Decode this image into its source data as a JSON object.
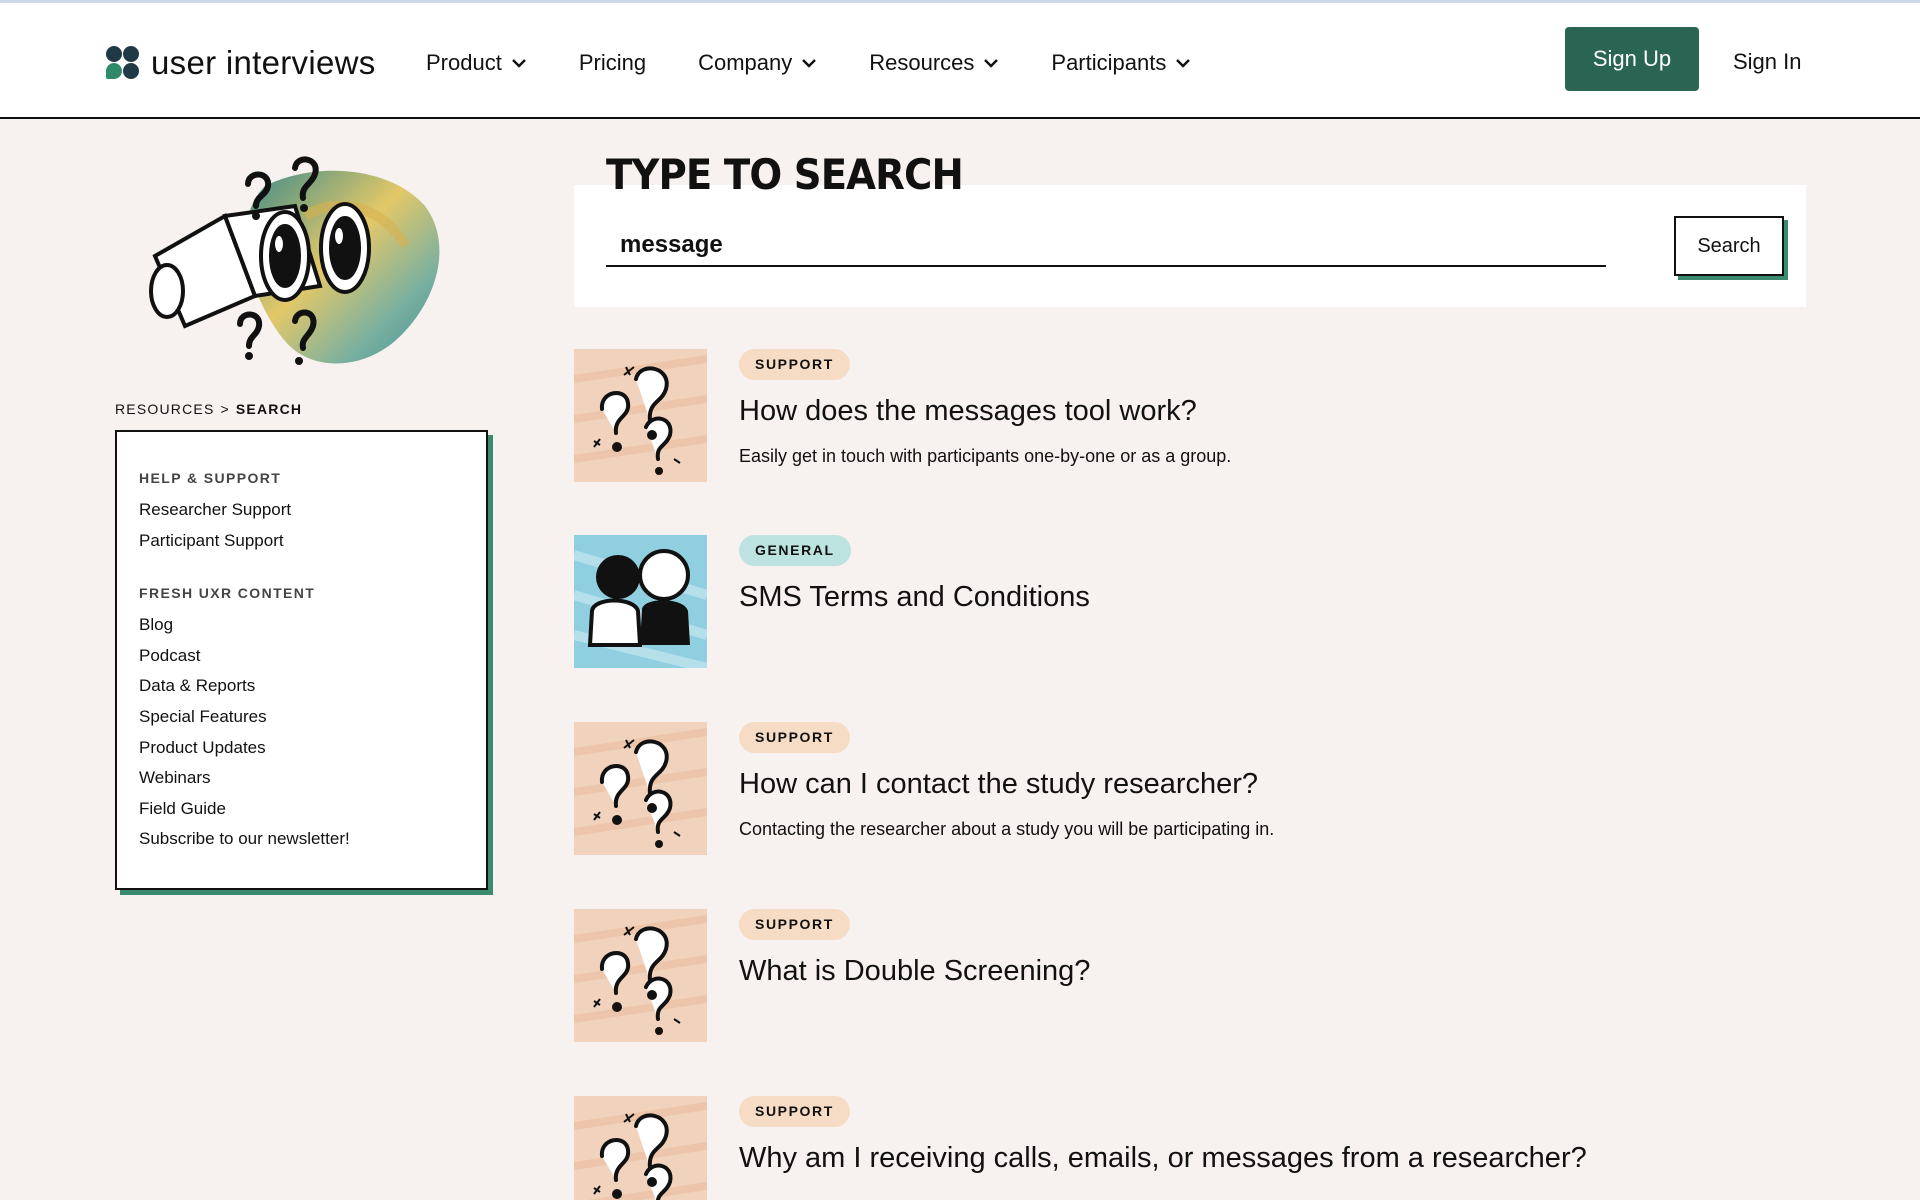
{
  "header": {
    "logo_text": "user interviews",
    "nav": [
      {
        "label": "Product",
        "dropdown": true
      },
      {
        "label": "Pricing",
        "dropdown": false
      },
      {
        "label": "Company",
        "dropdown": true
      },
      {
        "label": "Resources",
        "dropdown": true
      },
      {
        "label": "Participants",
        "dropdown": true
      }
    ],
    "signup_label": "Sign Up",
    "signin_label": "Sign In"
  },
  "breadcrumb": {
    "parent": "RESOURCES",
    "separator": ">",
    "current": "SEARCH"
  },
  "sidebar": {
    "groups": [
      {
        "heading": "HELP & SUPPORT",
        "links": [
          "Researcher Support",
          "Participant Support"
        ]
      },
      {
        "heading": "FRESH UXR CONTENT",
        "links": [
          "Blog",
          "Podcast",
          "Data & Reports",
          "Special Features",
          "Product Updates",
          "Webinars",
          "Field Guide",
          "Subscribe to our newsletter!"
        ]
      }
    ]
  },
  "search": {
    "title": "TYPE TO SEARCH",
    "value": "message",
    "button_label": "Search"
  },
  "results": [
    {
      "tag": "SUPPORT",
      "title": "How does the messages tool work?",
      "description": "Easily get in touch with participants one-by-one or as a group.",
      "thumb": "question-marks"
    },
    {
      "tag": "GENERAL",
      "title": "SMS Terms and Conditions",
      "description": "",
      "thumb": "people"
    },
    {
      "tag": "SUPPORT",
      "title": "How can I contact the study researcher?",
      "description": "Contacting the researcher about a study you will be participating in.",
      "thumb": "question-marks"
    },
    {
      "tag": "SUPPORT",
      "title": "What is Double Screening?",
      "description": "",
      "thumb": "question-marks"
    },
    {
      "tag": "SUPPORT",
      "title": "Why am I receiving calls, emails, or messages from a researcher?",
      "description": "",
      "thumb": "question-marks"
    }
  ],
  "colors": {
    "brand_green": "#2a6554",
    "accent_shadow": "#3a8a70",
    "support_tag": "#f6dcc4",
    "general_tag": "#bde3e0",
    "page_bg": "#f7f1f0"
  }
}
